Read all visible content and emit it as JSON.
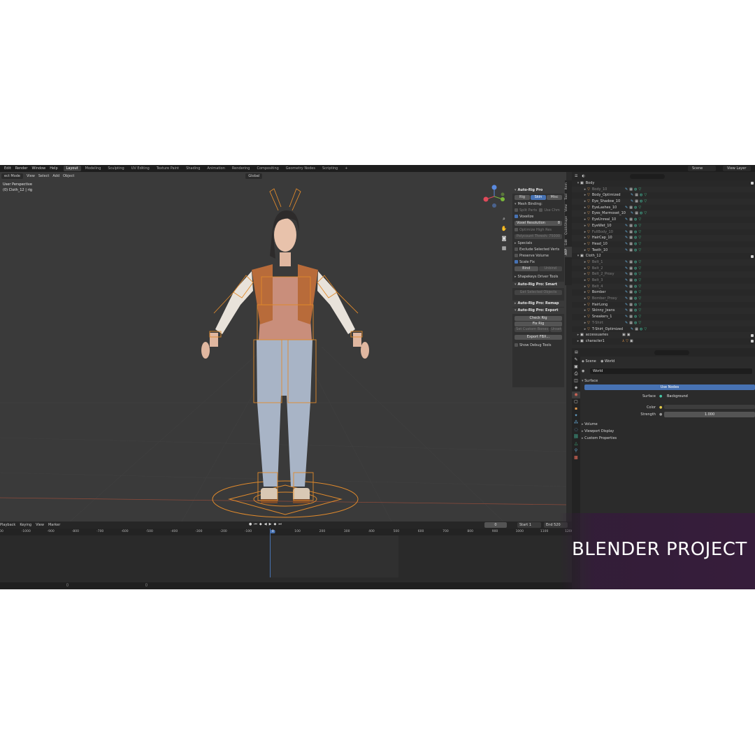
{
  "topbar": {
    "menus": [
      "Edit",
      "Render",
      "Window",
      "Help"
    ],
    "workspaces": [
      "Layout",
      "Modeling",
      "Sculpting",
      "UV Editing",
      "Texture Paint",
      "Shading",
      "Animation",
      "Rendering",
      "Compositing",
      "Geometry Nodes",
      "Scripting",
      "+"
    ],
    "active_workspace": "Layout",
    "scene": "Scene",
    "view_layer": "View Layer"
  },
  "viewport": {
    "header": {
      "mode": "ect Mode",
      "menus": [
        "View",
        "Select",
        "Add",
        "Object"
      ],
      "orientation": "Global"
    },
    "info_view": "User Perspective",
    "info_object": "(0) Cloth_12 | rig"
  },
  "npanel": {
    "title": "Auto-Rig Pro",
    "tabs": [
      "Rig",
      "Skin",
      "Misc"
    ],
    "active_tab": "Skin",
    "mesh_binding": "Mesh Binding:",
    "split_parts": "Split Parts",
    "use_chm": "Use Chm",
    "voxelize": "Voxelize",
    "voxel_resolution": "Voxel Resolution",
    "voxel_resolution_value": "8",
    "optimize_high_res": "Optimize High Res",
    "polycount_thresh": "Polycount Thresh: 75000",
    "specials": "Specials",
    "exclude_selected_verts": "Exclude Selected Verts",
    "preserve_volume": "Preserve Volume",
    "scale_fix": "Scale Fix",
    "bind": "Bind",
    "unbind": "Unbind",
    "shapekeys_driver_tools": "Shapekeys Driver Tools",
    "smart_panel": "Auto-Rig Pro: Smart",
    "get_selected_objects": "Get Selected Objects",
    "remap_panel": "Auto-Rig Pro: Remap",
    "export_panel": "Auto-Rig Pro: Export",
    "check_rig": "Check Rig",
    "fix_rig": "Fix Rig",
    "set_custom_bones": "Set Custom Bones",
    "unset": "Unset",
    "export_fbx": "Export FBX...",
    "show_debug_tools": "Show Debug Tools",
    "vertical_tabs": [
      "Item",
      "Tool",
      "View",
      "QuickShape",
      "Edit",
      "ARP"
    ]
  },
  "timeline": {
    "menus": [
      "Playback",
      "Keying",
      "View",
      "Marker"
    ],
    "current_frame": "0",
    "start_label": "Start",
    "start_value": "1",
    "end_label": "End",
    "end_value": "520",
    "ruler": [
      "00",
      "-1000",
      "-900",
      "-800",
      "-700",
      "-600",
      "-500",
      "-400",
      "-300",
      "-200",
      "-100",
      "0",
      "100",
      "200",
      "300",
      "400",
      "500",
      "600",
      "700",
      "800",
      "900",
      "1000",
      "1100",
      "1200"
    ]
  },
  "outliner": {
    "rows": [
      {
        "name": "Body",
        "type": "collection",
        "indent": 0,
        "dim": false
      },
      {
        "name": "Body_10",
        "type": "mesh",
        "indent": 1,
        "dim": true
      },
      {
        "name": "Body_Optimized",
        "type": "mesh",
        "indent": 1,
        "dim": false
      },
      {
        "name": "Eye_Shadow_10",
        "type": "mesh",
        "indent": 1,
        "dim": false
      },
      {
        "name": "EyeLashes_10",
        "type": "mesh",
        "indent": 1,
        "dim": false
      },
      {
        "name": "Eyes_Marmoset_10",
        "type": "mesh",
        "indent": 1,
        "dim": false
      },
      {
        "name": "EyeUnreal_10",
        "type": "mesh",
        "indent": 1,
        "dim": false
      },
      {
        "name": "EyeWet_10",
        "type": "mesh",
        "indent": 1,
        "dim": false
      },
      {
        "name": "FullBody_10",
        "type": "mesh",
        "indent": 1,
        "dim": true
      },
      {
        "name": "HairCap_10",
        "type": "mesh",
        "indent": 1,
        "dim": false
      },
      {
        "name": "Head_10",
        "type": "mesh",
        "indent": 1,
        "dim": false
      },
      {
        "name": "Teeth_10",
        "type": "mesh",
        "indent": 1,
        "dim": false
      },
      {
        "name": "Cloth_12",
        "type": "collection",
        "indent": 0,
        "dim": false
      },
      {
        "name": "Belt_1",
        "type": "mesh",
        "indent": 1,
        "dim": true
      },
      {
        "name": "Belt_2",
        "type": "mesh",
        "indent": 1,
        "dim": true
      },
      {
        "name": "Belt_2_Proxy",
        "type": "mesh",
        "indent": 1,
        "dim": true
      },
      {
        "name": "Belt_3",
        "type": "mesh",
        "indent": 1,
        "dim": true
      },
      {
        "name": "Belt_4",
        "type": "mesh",
        "indent": 1,
        "dim": true
      },
      {
        "name": "Bomber",
        "type": "mesh",
        "indent": 1,
        "dim": false
      },
      {
        "name": "Bomber_Proxy",
        "type": "mesh",
        "indent": 1,
        "dim": true
      },
      {
        "name": "HairLong",
        "type": "mesh",
        "indent": 1,
        "dim": false
      },
      {
        "name": "Skinny_Jeans",
        "type": "mesh",
        "indent": 1,
        "dim": false
      },
      {
        "name": "Sneakers_1",
        "type": "mesh",
        "indent": 1,
        "dim": false
      },
      {
        "name": "T-Shirt",
        "type": "mesh",
        "indent": 1,
        "dim": true
      },
      {
        "name": "T-Shirt_Optimized",
        "type": "mesh",
        "indent": 1,
        "dim": false
      },
      {
        "name": "accessuaries",
        "type": "collection",
        "indent": 0,
        "dim": false
      },
      {
        "name": "character1",
        "type": "collection",
        "indent": 0,
        "dim": false
      }
    ]
  },
  "properties": {
    "scene_tab": "Scene",
    "world_tab": "World",
    "world_name": "World",
    "surface_panel": "Surface",
    "use_nodes": "Use Nodes",
    "surface_label": "Surface",
    "surface_value": "Background",
    "color_label": "Color",
    "strength_label": "Strength",
    "strength_value": "1.000",
    "volume_panel": "Volume",
    "viewport_display_panel": "Viewport Display",
    "custom_properties_panel": "Custom Properties"
  },
  "overlay_title": "BLENDER PROJECT",
  "colors": {
    "accent": "#4772b3",
    "rig": "#e08a2c",
    "overlay": "#371c3c"
  }
}
